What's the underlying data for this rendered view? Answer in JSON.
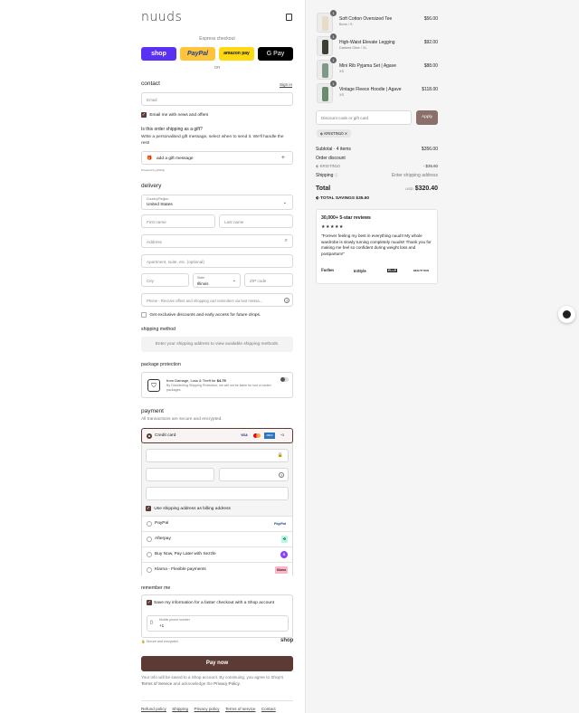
{
  "brand": "nuuds",
  "express": {
    "title": "Express checkout",
    "buttons": [
      "shop",
      "PayPal",
      "amazon pay",
      "G Pay"
    ],
    "or": "OR"
  },
  "contact": {
    "title": "contact",
    "sign_in": "Sign in",
    "email_placeholder": "Email",
    "newsletter": "Email me with news and offers"
  },
  "gift": {
    "question": "Is this order shipping as a gift?",
    "desc": "Write a personalised gift message, select when to send it. We'll handle the rest!",
    "button": "add a gift message",
    "powered": "Powered by giftship"
  },
  "delivery": {
    "title": "delivery",
    "country_label": "Country/Region",
    "country": "United States",
    "first_name": "First name",
    "last_name": "Last name",
    "address": "Address",
    "apartment": "Apartment, suite, etc. (optional)",
    "city": "City",
    "state_label": "State",
    "state": "Illinois",
    "zip": "ZIP code",
    "phone": "Phone - Receive offers and shopping cart reminders via text messa...",
    "exclusive": "Get exclusive discounts and early access for future drops."
  },
  "shipping": {
    "title": "shipping method",
    "notice": "Enter your shipping address to view available shipping methods."
  },
  "protection": {
    "title": "package protection",
    "line1_prefix": "from Damage, Loss & Theft for",
    "price": "$4.75",
    "line2": "By Deselecting Shipping Protection, we will not be liable for lost or stolen packages."
  },
  "payment": {
    "title": "payment",
    "subtitle": "All transactions are secure and encrypted.",
    "credit_card": "Credit card",
    "card_logos": [
      "VISA",
      "MC",
      "AMEX",
      "+3"
    ],
    "billing_same": "Use shipping address as billing address",
    "methods": [
      {
        "label": "PayPal",
        "badge": "PayPal",
        "color": "#1b3f8f",
        "bg": "#ffffff"
      },
      {
        "label": "Afterpay",
        "badge": "⟲",
        "color": "#000000",
        "bg": "#b2fce4"
      },
      {
        "label": "Buy Now, Pay Later with Sezzle",
        "badge": "S",
        "color": "#ffffff",
        "bg": "#8a3ffc"
      },
      {
        "label": "Klarna - Flexible payments",
        "badge": "Klarna",
        "color": "#000000",
        "bg": "#ffb3c7"
      }
    ]
  },
  "remember": {
    "title": "remember me",
    "save": "Save my information for a faster checkout with a Shop account",
    "mobile_label": "Mobile phone number",
    "mobile_value": "+1",
    "secure": "Secure and encrypted",
    "shop": "shop"
  },
  "pay_now": "Pay now",
  "legal": {
    "text1": "Your info will be saved to a Shop account. By continuing, you agree to Shop's",
    "tos": "Terms of Service",
    "text2": "and acknowledge the",
    "privacy": "Privacy Policy."
  },
  "footer_links": [
    "Refund policy",
    "Shipping",
    "Privacy policy",
    "Terms of service",
    "Contact"
  ],
  "cart": {
    "items": [
      {
        "qty": "1",
        "name": "Soft Cotton Oversized Tee",
        "variant": "Bone / S",
        "price": "$56.00",
        "color": "#e8dcc8"
      },
      {
        "qty": "1",
        "name": "High-Waist Elevate Legging",
        "variant": "Darkest Olive / XL",
        "price": "$92.00",
        "color": "#3c3f33"
      },
      {
        "qty": "1",
        "name": "Mini Rib Pyjama Set | Agave",
        "variant": "XS",
        "price": "$88.00",
        "color": "#7d9a88"
      },
      {
        "qty": "1",
        "name": "Vintage Fleece Hoodie | Agave",
        "variant": "XS",
        "price": "$118.00",
        "color": "#6b8a6e"
      }
    ],
    "discount_placeholder": "Discount code or gift card",
    "apply": "Apply",
    "code_chip": "KRISTIN10",
    "subtotal_label": "Subtotal · 4 items",
    "subtotal": "$356.00",
    "order_discount": "Order discount",
    "discount_code": "KRISTIN10",
    "discount_value": "- $35.60",
    "shipping_label": "Shipping",
    "shipping_value": "Enter shipping address",
    "total_label": "Total",
    "currency": "USD",
    "total": "$320.40",
    "savings_label": "TOTAL SAVINGS",
    "savings": "$35.60"
  },
  "reviews": {
    "title": "30,000+ 5-star reviews",
    "stars": "★★★★★",
    "quote": "\"Forever feeling my best in everything nuud!! My whole wardrobe is slowly turning completely nuuds!! Thank you for making me feel so confident during weight loss and postpartum!\"",
    "press": [
      "Forbes",
      "InStyle",
      "ELLE",
      "BEAUTY RUN"
    ]
  }
}
